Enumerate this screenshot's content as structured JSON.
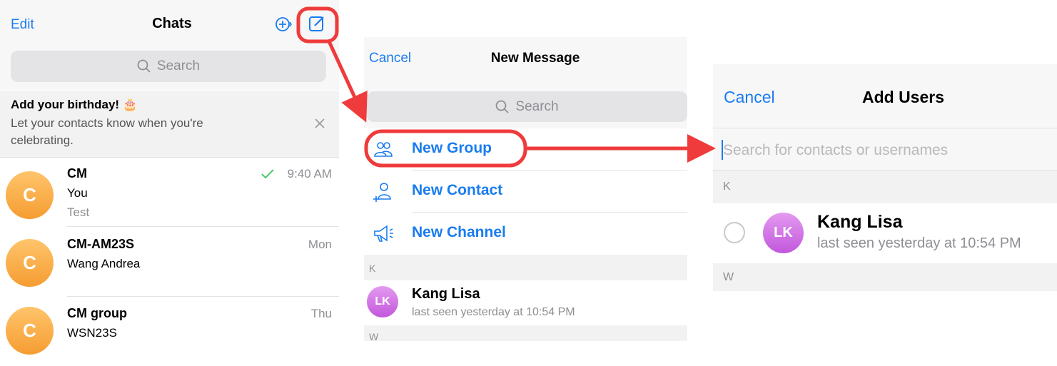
{
  "chats_screen": {
    "edit_label": "Edit",
    "title": "Chats",
    "search_placeholder": "Search",
    "birthday_banner": {
      "title": "Add your birthday! 🎂",
      "text": "Let your contacts know when you're celebrating."
    },
    "chats": [
      {
        "avatar": "C",
        "name": "CM",
        "line1": "You",
        "line2": "Test",
        "time": "9:40 AM",
        "read": true
      },
      {
        "avatar": "C",
        "name": "CM-AM23S",
        "line1": "Wang Andrea",
        "line2": "",
        "time": "Mon"
      },
      {
        "avatar": "C",
        "name": "CM group",
        "line1": "WSN23S",
        "line2": "",
        "time": "Thu"
      }
    ]
  },
  "new_message_screen": {
    "cancel_label": "Cancel",
    "title": "New Message",
    "search_placeholder": "Search",
    "actions": [
      {
        "label": "New Group",
        "icon": "group-icon"
      },
      {
        "label": "New Contact",
        "icon": "add-contact-icon"
      },
      {
        "label": "New Channel",
        "icon": "megaphone-icon"
      }
    ],
    "section_k": "K",
    "contact": {
      "initials": "LK",
      "name": "Kang Lisa",
      "status": "last seen yesterday at 10:54 PM"
    },
    "section_w": "W"
  },
  "add_users_screen": {
    "cancel_label": "Cancel",
    "title": "Add Users",
    "search_placeholder": "Search for contacts or usernames",
    "section_k": "K",
    "contact": {
      "initials": "LK",
      "name": "Kang Lisa",
      "status": "last seen yesterday at 10:54 PM"
    },
    "section_w": "W"
  },
  "colors": {
    "accent": "#1a7cf0",
    "annotation": "#ef3b3b",
    "avatar_orange": "#f7a940",
    "avatar_purple": "#d27ae8",
    "read_check": "#34c759"
  }
}
